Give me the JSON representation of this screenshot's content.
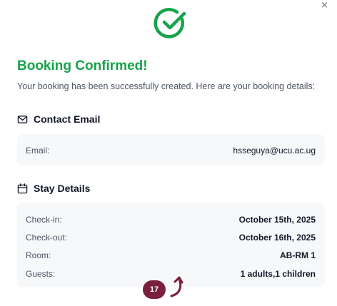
{
  "dialog": {
    "close_glyph": "×",
    "title": "Booking Confirmed!",
    "subtitle": "Your booking has been successfully created. Here are your booking details:"
  },
  "contact": {
    "heading": "Contact Email",
    "email_label": "Email:",
    "email_value": "hsseguya@ucu.ac.ug"
  },
  "stay": {
    "heading": "Stay Details",
    "rows": [
      {
        "label": "Check-in:",
        "value": "October 15th, 2025"
      },
      {
        "label": "Check-out:",
        "value": "October 16th, 2025"
      },
      {
        "label": "Room:",
        "value": "AB-RM 1"
      },
      {
        "label": "Guests:",
        "value": "1 adults,1 children"
      }
    ]
  },
  "overlay": {
    "badge_number": "17"
  },
  "colors": {
    "success": "#16a34a",
    "badge": "#7a1f3c",
    "card_bg": "#f7f8fa"
  },
  "icons": {
    "success": "check-circle-icon",
    "contact": "mail-icon",
    "stay": "calendar-icon",
    "close": "close-icon",
    "annotation": "curved-arrow-icon"
  }
}
